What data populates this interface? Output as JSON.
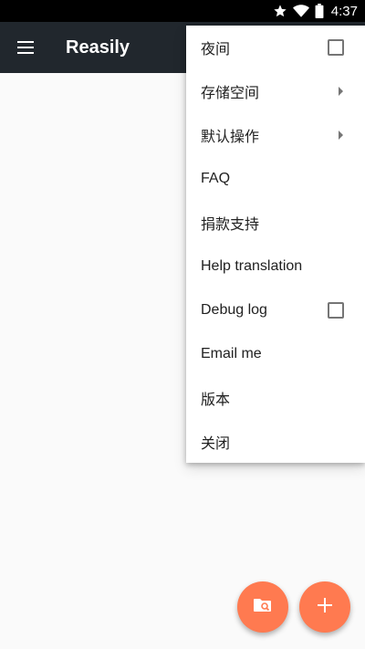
{
  "status_bar": {
    "time": "4:37",
    "icons": [
      "star-icon",
      "wifi-icon",
      "battery-icon"
    ]
  },
  "toolbar": {
    "menu_icon": "hamburger-menu-icon",
    "title": "Reasily"
  },
  "overflow_menu": {
    "items": [
      {
        "label": "夜间",
        "control": "checkbox",
        "checked": false
      },
      {
        "label": "存储空间",
        "control": "submenu-arrow"
      },
      {
        "label": "默认操作",
        "control": "submenu-arrow"
      },
      {
        "label": "FAQ"
      },
      {
        "label": "捐款支持"
      },
      {
        "label": "Help translation"
      },
      {
        "label": "Debug log",
        "control": "checkbox",
        "checked": false
      },
      {
        "label": "Email me"
      },
      {
        "label": "版本"
      },
      {
        "label": "关闭"
      }
    ]
  },
  "fabs": {
    "folder_search": {
      "icon": "folder-search-icon"
    },
    "add": {
      "icon": "plus-icon"
    }
  },
  "colors": {
    "toolbar_bg": "#21272d",
    "accent": "#ff7a50",
    "status_bar_bg": "#000000",
    "background": "#fafafa"
  }
}
